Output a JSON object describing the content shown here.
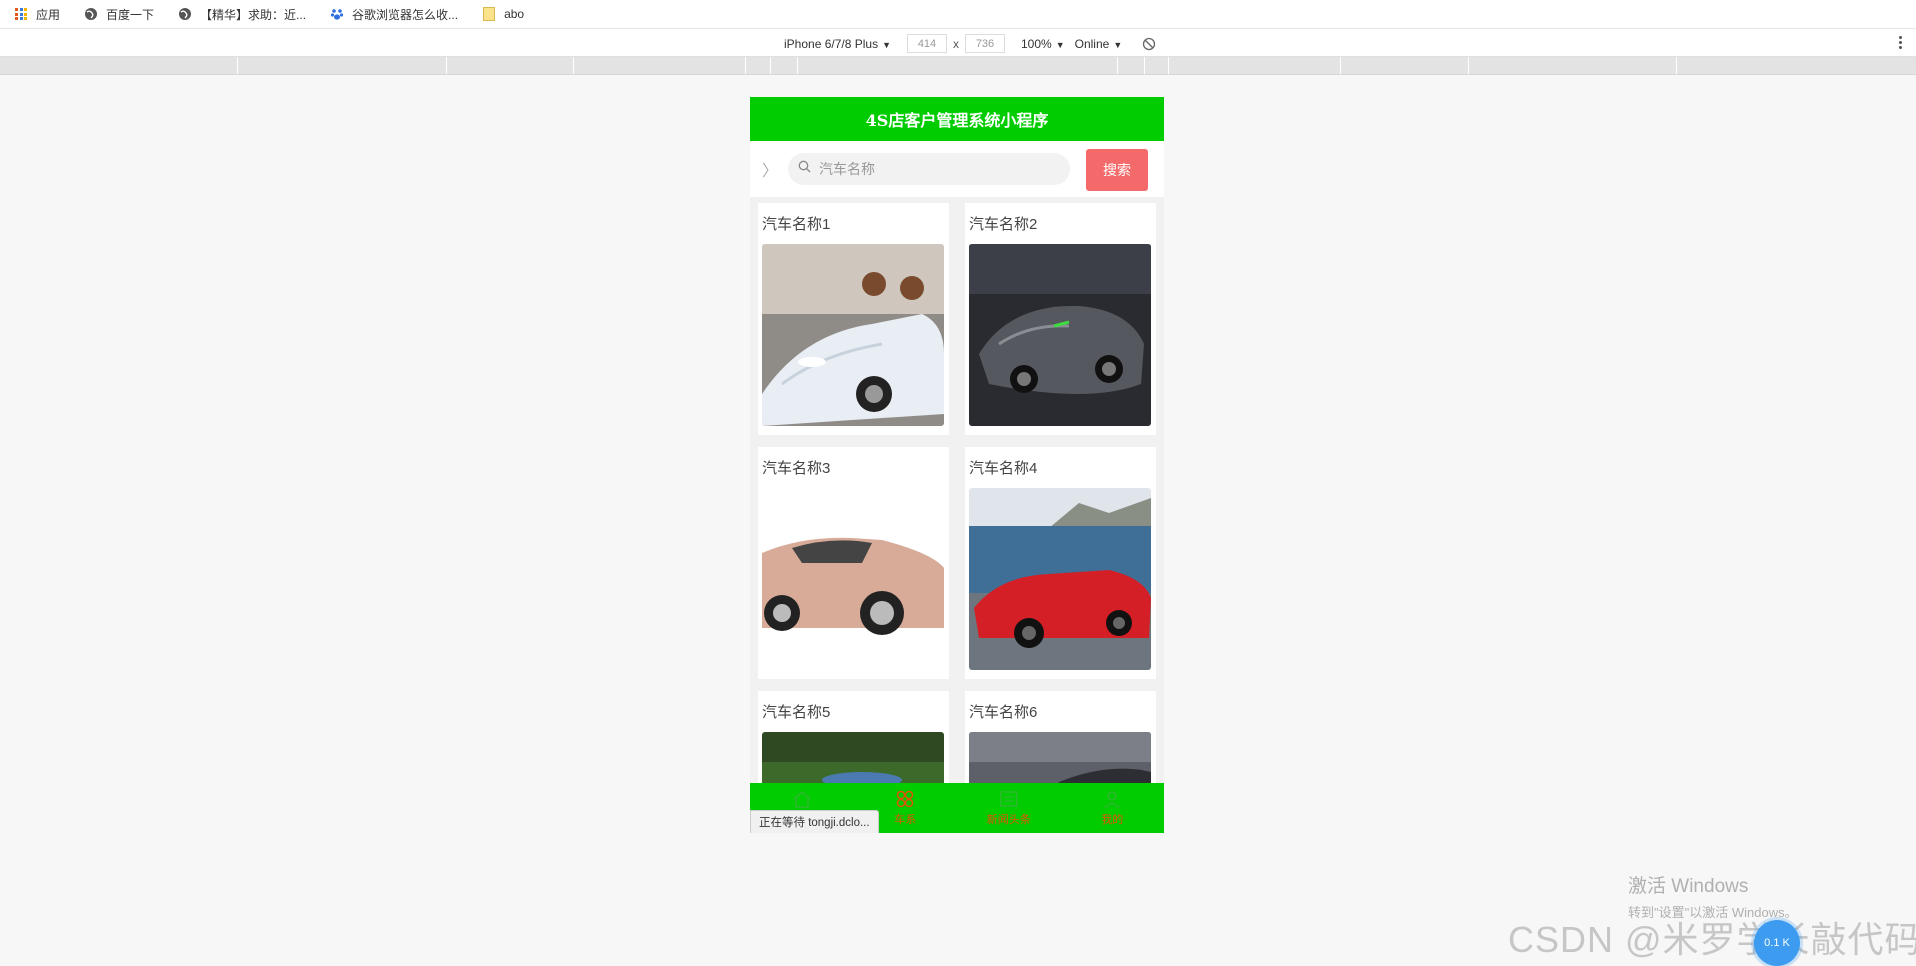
{
  "bookmarks": [
    {
      "label": "应用",
      "icon": "apps-grid-icon"
    },
    {
      "label": "百度一下",
      "icon": "globe-icon"
    },
    {
      "label": "【精华】求助：近...",
      "icon": "globe-icon"
    },
    {
      "label": "谷歌浏览器怎么收...",
      "icon": "baidu-paw-icon"
    },
    {
      "label": "abo",
      "icon": "folder-icon"
    }
  ],
  "device_toolbar": {
    "device": "iPhone 6/7/8 Plus",
    "width": "414",
    "separator": "x",
    "height": "736",
    "zoom": "100%",
    "network": "Online"
  },
  "app": {
    "title": "4S店客户管理系统小程序",
    "search_placeholder": "汽车名称",
    "search_button": "搜索",
    "cars": [
      {
        "name": "汽车名称1"
      },
      {
        "name": "汽车名称2"
      },
      {
        "name": "汽车名称3"
      },
      {
        "name": "汽车名称4"
      },
      {
        "name": "汽车名称5"
      },
      {
        "name": "汽车名称6"
      }
    ],
    "tabs": [
      {
        "label": "首页",
        "icon": "home-icon"
      },
      {
        "label": "车系",
        "icon": "category-icon"
      },
      {
        "label": "新闻头条",
        "icon": "news-icon"
      },
      {
        "label": "我的",
        "icon": "user-icon"
      }
    ],
    "status_popup": "正在等待 tongji.dclo..."
  },
  "watermark": {
    "activate_title": "激活 Windows",
    "activate_sub": "转到\"设置\"以激活 Windows。",
    "csdn": "CSDN @米罗学长敲代码",
    "bubble": "0.1 K"
  },
  "colors": {
    "header_green": "#00cc00",
    "search_button": "#f46a6a",
    "tab_text": "#e0520a"
  }
}
